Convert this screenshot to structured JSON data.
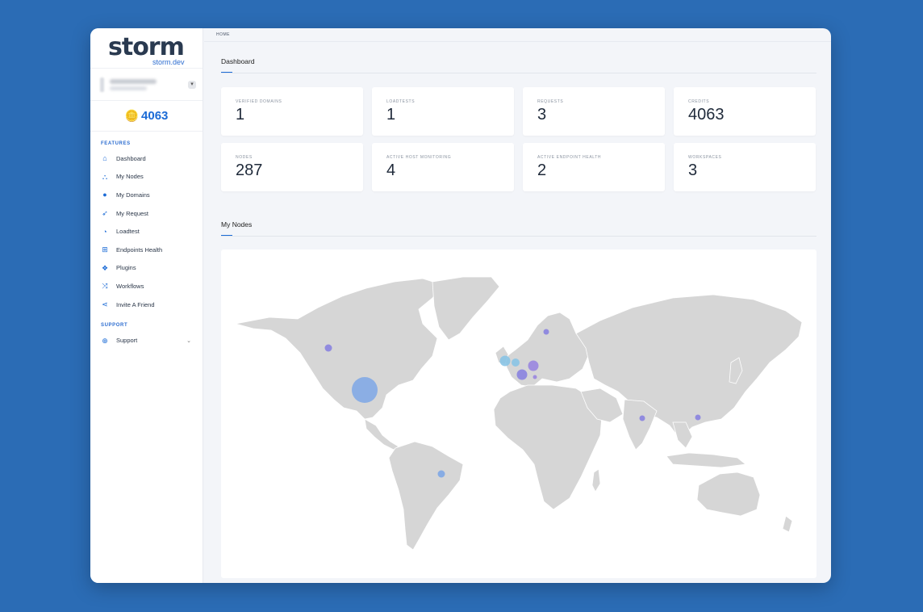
{
  "brand": {
    "name": "storm",
    "domain": "storm.dev"
  },
  "account": {
    "caret_icon": "chevron-down-icon"
  },
  "credits_balance": "4063",
  "sidebar": {
    "features_title": "FEATURES",
    "support_title": "SUPPORT",
    "items": [
      {
        "label": "Dashboard",
        "icon": "home-icon"
      },
      {
        "label": "My Nodes",
        "icon": "sitemap-icon"
      },
      {
        "label": "My Domains",
        "icon": "globe-icon"
      },
      {
        "label": "My Request",
        "icon": "rocket-icon"
      },
      {
        "label": "Loadtest",
        "icon": "clock-icon"
      },
      {
        "label": "Endpoints Health",
        "icon": "medkit-icon"
      },
      {
        "label": "Plugins",
        "icon": "cubes-icon"
      },
      {
        "label": "Workflows",
        "icon": "random-icon"
      },
      {
        "label": "Invite A Friend",
        "icon": "share-icon"
      }
    ],
    "support_item": {
      "label": "Support",
      "icon": "lifebuoy-icon"
    }
  },
  "breadcrumb": "HOME",
  "dashboard": {
    "title": "Dashboard",
    "stats": [
      {
        "label": "VERIFIED DOMAINS",
        "value": "1"
      },
      {
        "label": "LOADTESTS",
        "value": "1"
      },
      {
        "label": "REQUESTS",
        "value": "3"
      },
      {
        "label": "CREDITS",
        "value": "4063"
      },
      {
        "label": "NODES",
        "value": "287"
      },
      {
        "label": "ACTIVE HOST MONITORING",
        "value": "4"
      },
      {
        "label": "ACTIVE ENDPOINT HEALTH",
        "value": "2"
      },
      {
        "label": "WORKSPACES",
        "value": "3"
      }
    ]
  },
  "nodes": {
    "title": "My Nodes",
    "markers": [
      {
        "region": "United States",
        "size": "large",
        "color": "#7ea7e6"
      },
      {
        "region": "Canada",
        "size": "small",
        "color": "#8a83e0"
      },
      {
        "region": "Brazil",
        "size": "small",
        "color": "#7ea7e6"
      },
      {
        "region": "Ireland",
        "size": "medium",
        "color": "#8ac4e6"
      },
      {
        "region": "United Kingdom",
        "size": "small",
        "color": "#8ac4e6"
      },
      {
        "region": "France",
        "size": "medium",
        "color": "#8a83e0"
      },
      {
        "region": "Germany",
        "size": "medium",
        "color": "#9a86e0"
      },
      {
        "region": "Italy",
        "size": "tiny",
        "color": "#9a86e0"
      },
      {
        "region": "Sweden",
        "size": "small",
        "color": "#8a83e0"
      },
      {
        "region": "India",
        "size": "small",
        "color": "#8a83e0"
      },
      {
        "region": "Hong Kong",
        "size": "small",
        "color": "#8a83e0"
      }
    ]
  }
}
